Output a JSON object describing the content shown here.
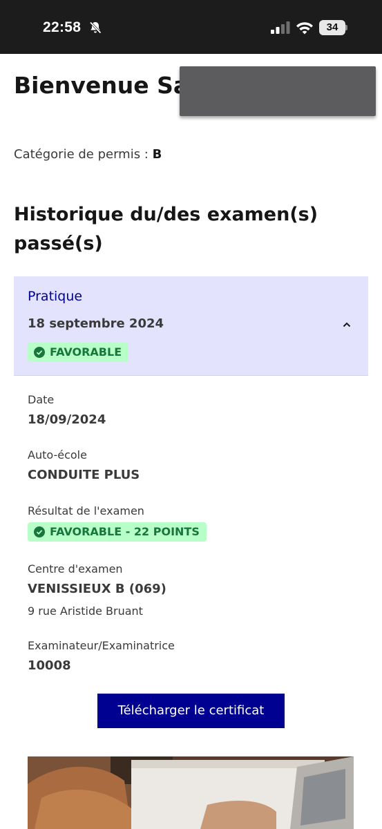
{
  "status_bar": {
    "time": "22:58",
    "battery": "34"
  },
  "header": {
    "welcome": "Bienvenue Saf"
  },
  "licence": {
    "label": "Catégorie de permis : ",
    "value": "B"
  },
  "history": {
    "title": "Historique du/des examen(s) passé(s)"
  },
  "exam": {
    "type": "Pratique",
    "date_title": "18 septembre 2024",
    "status_badge": "FAVORABLE",
    "expanded": true,
    "details": {
      "date_label": "Date",
      "date_value": "18/09/2024",
      "school_label": "Auto-école",
      "school_value": "CONDUITE PLUS",
      "result_label": "Résultat de l'examen",
      "result_value": "FAVORABLE - 22 POINTS",
      "center_label": "Centre d'examen",
      "center_value": "VENISSIEUX B (069)",
      "center_address": "9 rue Aristide Bruant",
      "examiner_label": "Examinateur/Examinatrice",
      "examiner_value": "10008"
    },
    "download_label": "Télécharger le certificat"
  },
  "colors": {
    "primary": "#000091",
    "accordion_bg": "#e3e3fd",
    "success_bg": "#b8fec9",
    "success_text": "#18753c"
  },
  "icons": [
    "bell-slash-icon",
    "signal-icon",
    "wifi-icon",
    "battery-icon",
    "chevron-up-icon",
    "check-circle-icon"
  ]
}
